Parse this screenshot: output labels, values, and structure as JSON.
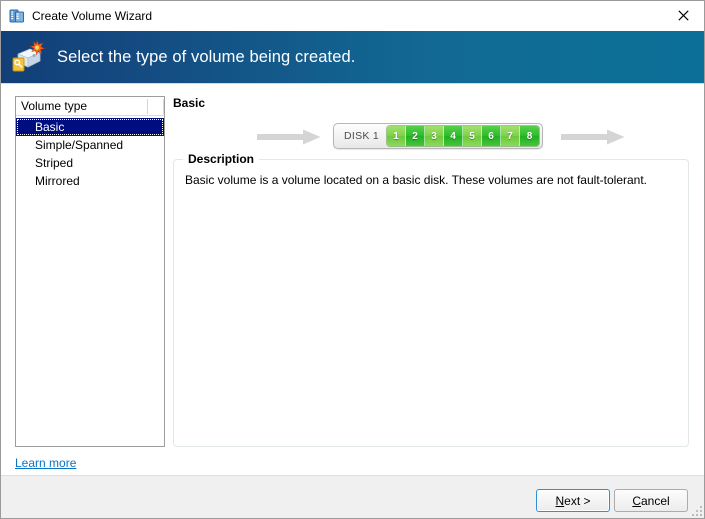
{
  "window": {
    "title": "Create Volume Wizard",
    "title_icon": "disk-stack-icon",
    "close_icon": "close-icon"
  },
  "banner": {
    "heading": "Select the type of volume being created.",
    "icon": "disk-wizard-icon",
    "gradient_left": "#123f77",
    "gradient_right": "#0c6f97"
  },
  "volume_list": {
    "header": "Volume type",
    "items": [
      {
        "label": "Basic",
        "selected": true
      },
      {
        "label": "Simple/Spanned",
        "selected": false
      },
      {
        "label": "Striped",
        "selected": false
      },
      {
        "label": "Mirrored",
        "selected": false
      }
    ],
    "selection_color": "#000d7e"
  },
  "detail": {
    "title": "Basic",
    "diagram": {
      "disk_label": "DISK 1",
      "blocks": [
        {
          "number": "1",
          "shade": "light"
        },
        {
          "number": "2",
          "shade": "dark"
        },
        {
          "number": "3",
          "shade": "light"
        },
        {
          "number": "4",
          "shade": "dark"
        },
        {
          "number": "5",
          "shade": "light"
        },
        {
          "number": "6",
          "shade": "dark"
        },
        {
          "number": "7",
          "shade": "light"
        },
        {
          "number": "8",
          "shade": "dark"
        }
      ],
      "arrow_left_icon": "arrow-right-icon",
      "arrow_right_icon": "arrow-right-icon",
      "block_color_light": "#7fd24b",
      "block_color_dark": "#2fbd2c",
      "arrow_color": "#d5d5d5"
    },
    "description": {
      "legend": "Description",
      "text": "Basic volume is a volume located on a basic disk. These volumes are not fault-tolerant."
    }
  },
  "links": {
    "learn_more": "Learn more",
    "learn_more_color": "#0b74c4"
  },
  "footer": {
    "next": {
      "accel": "N",
      "rest": "ext >"
    },
    "cancel": {
      "accel": "C",
      "rest": "ancel"
    },
    "resize_grip_icon": "resize-grip-icon"
  }
}
